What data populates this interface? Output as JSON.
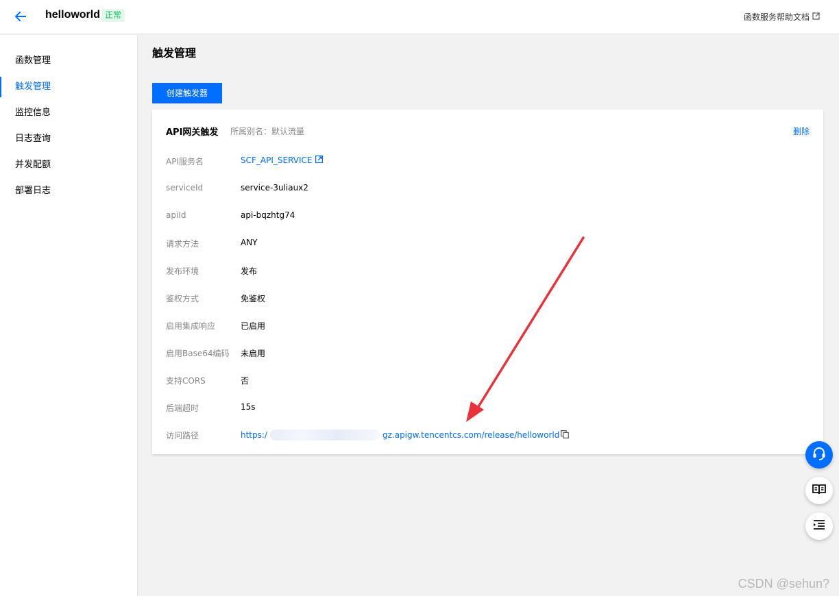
{
  "header": {
    "app_name": "helloworld",
    "status": "正常",
    "help_link": "函数服务帮助文档"
  },
  "sidebar": {
    "items": [
      {
        "label": "函数管理",
        "active": false
      },
      {
        "label": "触发管理",
        "active": true
      },
      {
        "label": "监控信息",
        "active": false
      },
      {
        "label": "日志查询",
        "active": false
      },
      {
        "label": "并发配额",
        "active": false
      },
      {
        "label": "部署日志",
        "active": false
      }
    ]
  },
  "main": {
    "title": "触发管理",
    "create_button": "创建触发器",
    "trigger_card": {
      "title": "API网关触发",
      "subtitle": "所属别名：默认流量",
      "delete": "删除",
      "rows": [
        {
          "label": "API服务名",
          "value": "SCF_API_SERVICE",
          "link": true
        },
        {
          "label": "serviceId",
          "value": "service-3uliaux2"
        },
        {
          "label": "apiId",
          "value": "api-bqzhtg74"
        },
        {
          "label": "请求方法",
          "value": "ANY"
        },
        {
          "label": "发布环境",
          "value": "发布"
        },
        {
          "label": "鉴权方式",
          "value": "免鉴权"
        },
        {
          "label": "启用集成响应",
          "value": "已启用"
        },
        {
          "label": "启用Base64编码",
          "value": "未启用"
        },
        {
          "label": "支持CORS",
          "value": "否"
        },
        {
          "label": "后端超时",
          "value": "15s"
        },
        {
          "label": "访问路径",
          "value_prefix": "https:/",
          "value_suffix": "gz.apigw.tencentcs.com/release/helloworld",
          "link": true
        }
      ]
    }
  },
  "watermark": "CSDN @sehun?",
  "colors": {
    "accent": "#006eff",
    "status_green": "#0abf5b",
    "annotation_arrow": "#e8333a"
  },
  "icons": [
    "back-arrow-icon",
    "external-link-icon",
    "copy-icon",
    "headset-icon",
    "book-icon",
    "list-icon"
  ]
}
